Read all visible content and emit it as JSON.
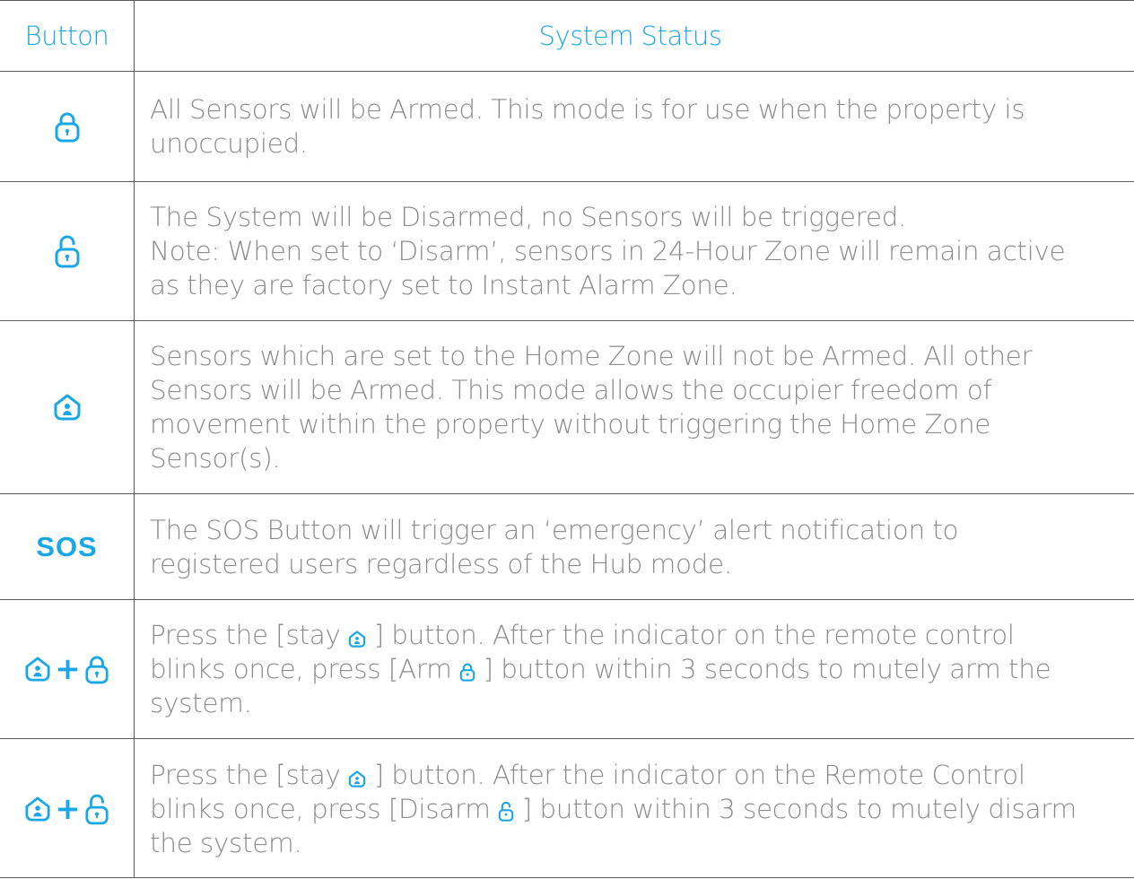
{
  "header": {
    "button": "Button",
    "status": "System Status"
  },
  "colors": {
    "accent": "#1aa7e6",
    "text": "#8c8c8c",
    "border": "#5a5a5a"
  },
  "rows": [
    {
      "button_icon": "arm-lock-icon",
      "lines": [
        "All Sensors will be Armed. This mode is for use when the property is",
        "unoccupied."
      ]
    },
    {
      "button_icon": "disarm-unlock-icon",
      "lines": [
        "The System will be Disarmed, no Sensors will be triggered.",
        "Note: When set to ‘Disarm’, sensors in 24-Hour Zone will remain active",
        "as they are factory set to Instant Alarm Zone."
      ]
    },
    {
      "button_icon": "home-stay-icon",
      "lines": [
        "Sensors which are set to the Home Zone will not be Armed. All other",
        "Sensors will be Armed. This mode allows the occupier freedom of",
        "movement within the property without triggering the Home Zone",
        "Sensor(s)."
      ]
    },
    {
      "button_label": "SOS",
      "lines": [
        "The SOS Button will trigger an ‘emergency’ alert notification to",
        "registered users regardless of the Hub mode."
      ]
    },
    {
      "button_icons": [
        "home-stay-icon",
        "plus",
        "arm-lock-icon"
      ],
      "plus": "+",
      "line1_a": "Press the [stay ",
      "line1_b": "] button. After the indicator on the remote control",
      "line2_a": "blinks once, press [Arm ",
      "line2_b": "] button within 3 seconds to mutely arm the",
      "line3": "system."
    },
    {
      "button_icons": [
        "home-stay-icon",
        "plus",
        "disarm-unlock-icon"
      ],
      "plus": "+",
      "line1_a": "Press the [stay ",
      "line1_b": "] button. After the indicator on the Remote Control",
      "line2_a": "blinks once, press [Disarm ",
      "line2_b": "] button within 3 seconds to mutely disarm",
      "line3": "the system."
    }
  ]
}
